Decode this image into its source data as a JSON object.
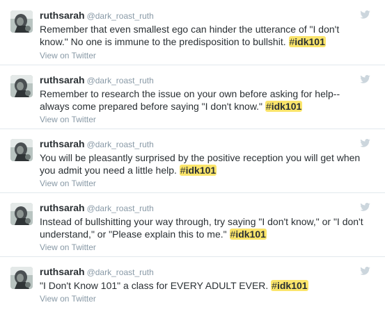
{
  "tweets": [
    {
      "display_name": "ruthsarah",
      "handle": "@dark_roast_ruth",
      "lines": [
        "Remember that even smallest ego can hinder the utterance of \"I don't",
        "know.\" No one is immune to the predisposition to bullshit. "
      ],
      "hash": "#",
      "tag": "idk101",
      "view_link": "View on Twitter"
    },
    {
      "display_name": "ruthsarah",
      "handle": "@dark_roast_ruth",
      "lines": [
        "Remember to research the issue on your own before asking for help--",
        "always come prepared before saying \"I don't know.\" "
      ],
      "hash": "#",
      "tag": "idk101",
      "view_link": "View on Twitter"
    },
    {
      "display_name": "ruthsarah",
      "handle": "@dark_roast_ruth",
      "lines": [
        "You will be pleasantly surprised by the positive reception you will get when",
        "you admit you need a little help. "
      ],
      "hash": "#",
      "tag": "idk101",
      "view_link": "View on Twitter"
    },
    {
      "display_name": "ruthsarah",
      "handle": "@dark_roast_ruth",
      "lines": [
        "Instead of bullshitting your way through, try saying \"I don't know,\" or \"I don't",
        "understand,\" or \"Please explain this to me.\" "
      ],
      "hash": "#",
      "tag": "idk101",
      "view_link": "View on Twitter"
    },
    {
      "display_name": "ruthsarah",
      "handle": "@dark_roast_ruth",
      "lines": [
        "\"I Don't Know 101\" a class for EVERY ADULT EVER. "
      ],
      "hash": "#",
      "tag": "idk101",
      "view_link": "View on Twitter"
    }
  ],
  "icons": {
    "avatar": "avatar-image",
    "bird": "twitter-bird-icon"
  },
  "colors": {
    "hashtag_highlight": "#fbe56b",
    "muted": "#8899a6",
    "text": "#292f33",
    "divider": "#e1e8ed",
    "bird": "#ccd6dd"
  }
}
